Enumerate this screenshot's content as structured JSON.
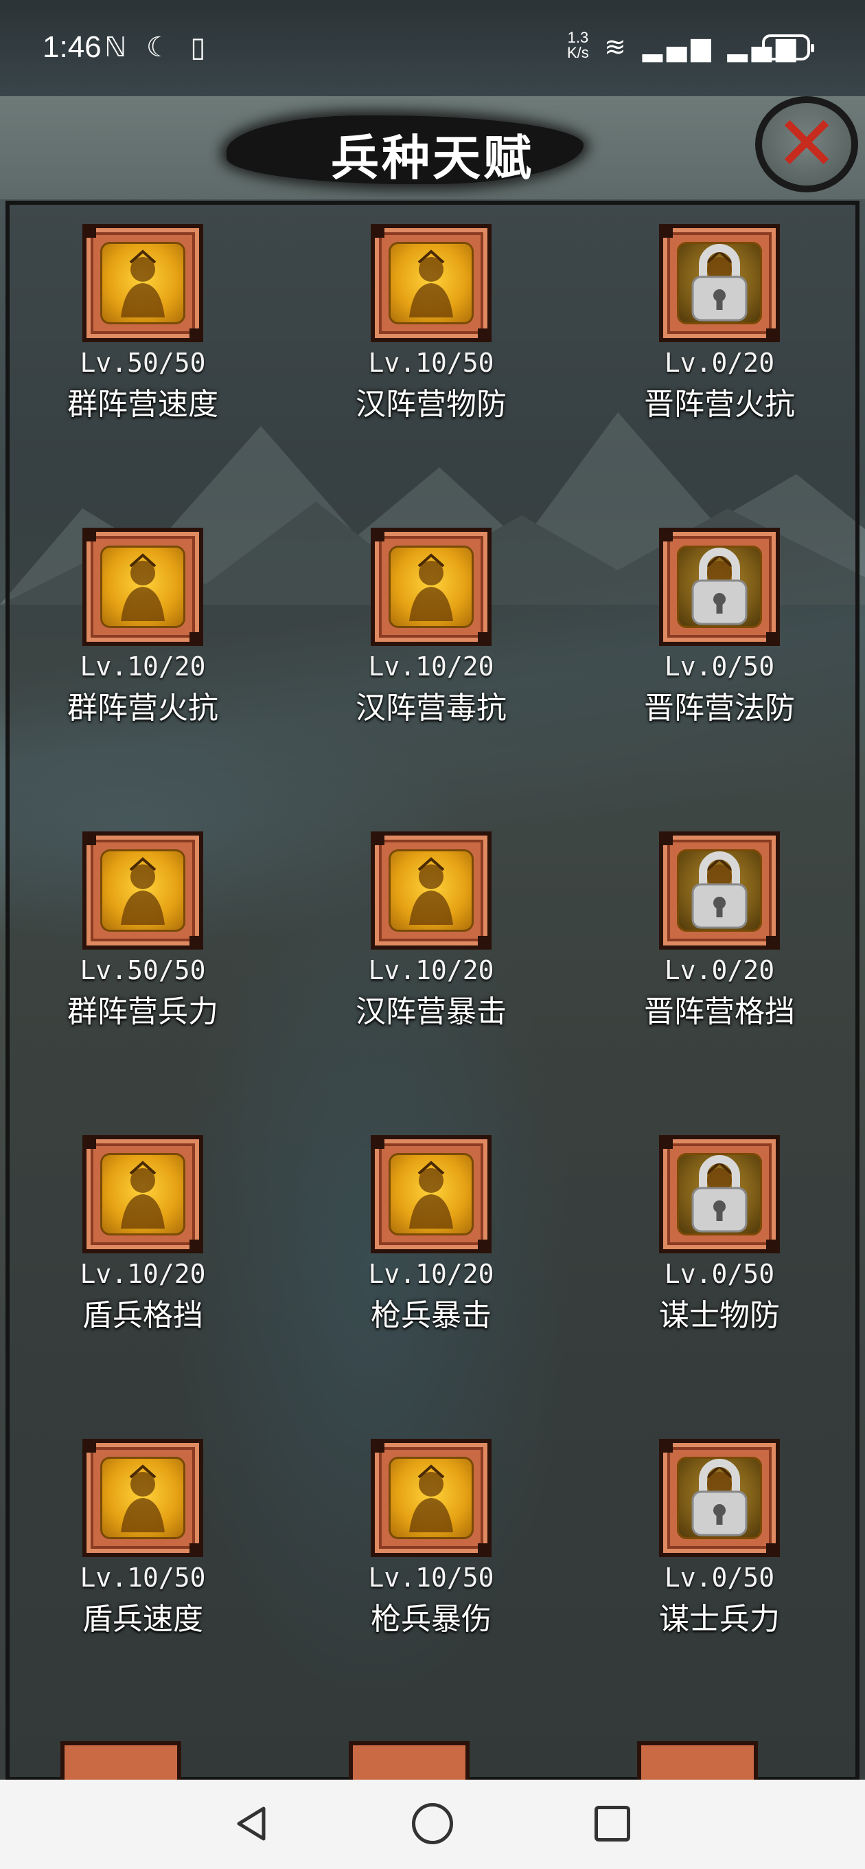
{
  "status_bar": {
    "time": "1:46",
    "left_icons": "ℕ ☾ ▯",
    "net_speed_top": "1.3",
    "net_speed_bottom": "K/s",
    "right_icons": "≋ ▂▄▆ ▂▄▆",
    "battery": "63"
  },
  "header": {
    "title": "兵种天赋",
    "close_label": "✕"
  },
  "talents": [
    {
      "level": "Lv.50/50",
      "name": "群阵营速度",
      "locked": false,
      "icon": "spear-warrior-icon"
    },
    {
      "level": "Lv.10/50",
      "name": "汉阵营物防",
      "locked": false,
      "icon": "shield-general-icon"
    },
    {
      "level": "Lv.0/20",
      "name": "晋阵营火抗",
      "locked": true,
      "icon": "lock-icon"
    },
    {
      "level": "Lv.10/20",
      "name": "群阵营火抗",
      "locked": false,
      "icon": "fire-general-icon"
    },
    {
      "level": "Lv.10/20",
      "name": "汉阵营毒抗",
      "locked": false,
      "icon": "mushroom-icon"
    },
    {
      "level": "Lv.0/50",
      "name": "晋阵营法防",
      "locked": true,
      "icon": "lock-icon"
    },
    {
      "level": "Lv.50/50",
      "name": "群阵营兵力",
      "locked": false,
      "icon": "general-portrait-icon"
    },
    {
      "level": "Lv.10/20",
      "name": "汉阵营暴击",
      "locked": false,
      "icon": "roaring-warrior-icon"
    },
    {
      "level": "Lv.0/20",
      "name": "晋阵营格挡",
      "locked": true,
      "icon": "lock-icon"
    },
    {
      "level": "Lv.10/20",
      "name": "盾兵格挡",
      "locked": false,
      "icon": "shield-soldier-icon"
    },
    {
      "level": "Lv.10/20",
      "name": "枪兵暴击",
      "locked": false,
      "icon": "spear-strike-icon"
    },
    {
      "level": "Lv.0/50",
      "name": "谋士物防",
      "locked": true,
      "icon": "lock-icon"
    },
    {
      "level": "Lv.10/50",
      "name": "盾兵速度",
      "locked": false,
      "icon": "running-shield-icon"
    },
    {
      "level": "Lv.10/50",
      "name": "枪兵暴伤",
      "locked": false,
      "icon": "lancer-icon"
    },
    {
      "level": "Lv.0/50",
      "name": "谋士兵力",
      "locked": true,
      "icon": "lock-icon"
    }
  ],
  "colors": {
    "frame": "#c96a45",
    "art_gold": "#ffd23a",
    "close_red": "#c62b1e"
  }
}
